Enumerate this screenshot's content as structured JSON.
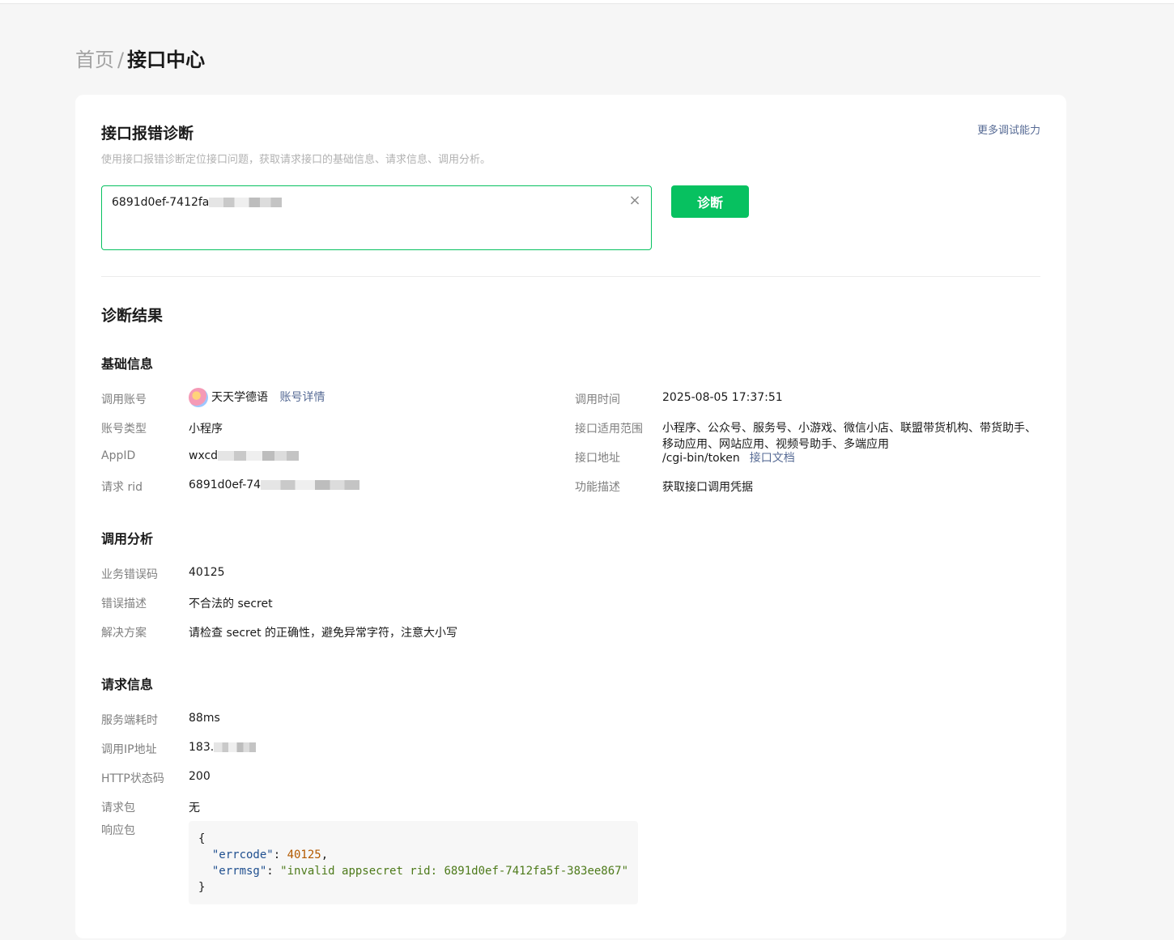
{
  "breadcrumb": {
    "home": "首页",
    "separator": "/",
    "current": "接口中心"
  },
  "header": {
    "title": "接口报错诊断",
    "description": "使用接口报错诊断定位接口问题，获取请求接口的基础信息、请求信息、调用分析。",
    "more_link": "更多调试能力"
  },
  "input": {
    "value": "6891d0ef-7412fa",
    "clear_icon": "close-icon"
  },
  "diagnose_button": "诊断",
  "result": {
    "title": "诊断结果",
    "basic": {
      "title": "基础信息",
      "account_label": "调用账号",
      "account_name": "天天学德语",
      "account_link": "账号详情",
      "account_type_label": "账号类型",
      "account_type": "小程序",
      "appid_label": "AppID",
      "appid": "wxcd",
      "rid_label": "请求 rid",
      "rid": "6891d0ef-74",
      "time_label": "调用时间",
      "time": "2025-08-05 17:37:51",
      "scope_label": "接口适用范围",
      "scope_line1": "小程序、公众号、服务号、小游戏、微信小店、联盟带货机构、带货助手、",
      "scope_line2": "移动应用、网站应用、视频号助手、多端应用",
      "url_label": "接口地址",
      "url": "/cgi-bin/token",
      "doc_link": "接口文档",
      "func_label": "功能描述",
      "func": "获取接口调用凭据"
    },
    "analysis": {
      "title": "调用分析",
      "errcode_label": "业务错误码",
      "errcode": "40125",
      "errdesc_label": "错误描述",
      "errdesc": "不合法的 secret",
      "solution_label": "解决方案",
      "solution": "请检查 secret 的正确性，避免异常字符，注意大小写"
    },
    "request": {
      "title": "请求信息",
      "cost_label": "服务端耗时",
      "cost": "88ms",
      "ip_label": "调用IP地址",
      "ip": "183.",
      "http_label": "HTTP状态码",
      "http": "200",
      "req_label": "请求包",
      "req": "无",
      "resp_label": "响应包",
      "resp": {
        "open": "{",
        "errcode_key": "\"errcode\"",
        "errcode_val": "40125",
        "errmsg_key": "\"errmsg\"",
        "errmsg_val": "\"invalid appsecret rid: 6891d0ef-7412fa5f-383ee867\"",
        "close": "}"
      }
    }
  }
}
